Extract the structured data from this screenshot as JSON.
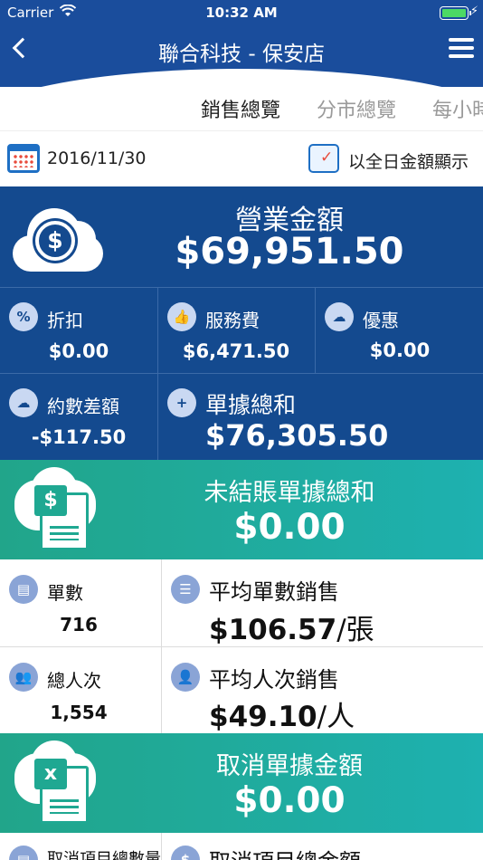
{
  "status": {
    "carrier": "Carrier",
    "time": "10:32 AM",
    "battery_level": 1.0
  },
  "nav": {
    "title": "聯合科技 - 保安店"
  },
  "tabs": [
    "銷售總覽",
    "分市總覽",
    "每小時"
  ],
  "date_row": {
    "date": "2016/11/30",
    "toggle_label": "以全日金額顯示"
  },
  "revenue": {
    "label": "營業金額",
    "value": "$69,951.50"
  },
  "grid": {
    "discount": {
      "label": "折扣",
      "value": "$0.00"
    },
    "service": {
      "label": "服務費",
      "value": "$6,471.50"
    },
    "promo": {
      "label": "優惠",
      "value": "$0.00"
    },
    "rounding": {
      "label": "約數差額",
      "value": "-$117.50"
    },
    "bill_total": {
      "label": "單據總和",
      "value": "$76,305.50"
    }
  },
  "unsettled": {
    "label": "未結賬單據總和",
    "value": "$0.00"
  },
  "stats": {
    "orders": {
      "label": "單數",
      "value": "716"
    },
    "avg_order": {
      "label": "平均單數銷售",
      "amount": "$106.57",
      "unit": "/張"
    },
    "guests": {
      "label": "總人次",
      "value": "1,554"
    },
    "avg_guest": {
      "label": "平均人次銷售",
      "amount": "$49.10",
      "unit": "/人"
    }
  },
  "cancelled": {
    "label": "取消單據金額",
    "value": "$0.00"
  },
  "bottom": {
    "left_label": "取消項目總數量",
    "right_label": "取消項目總金額"
  },
  "colors": {
    "nav_blue": "#1a4d9c",
    "block_blue": "#144a8f",
    "teal": "#21a58a",
    "icon_light": "#c9d8f2"
  }
}
